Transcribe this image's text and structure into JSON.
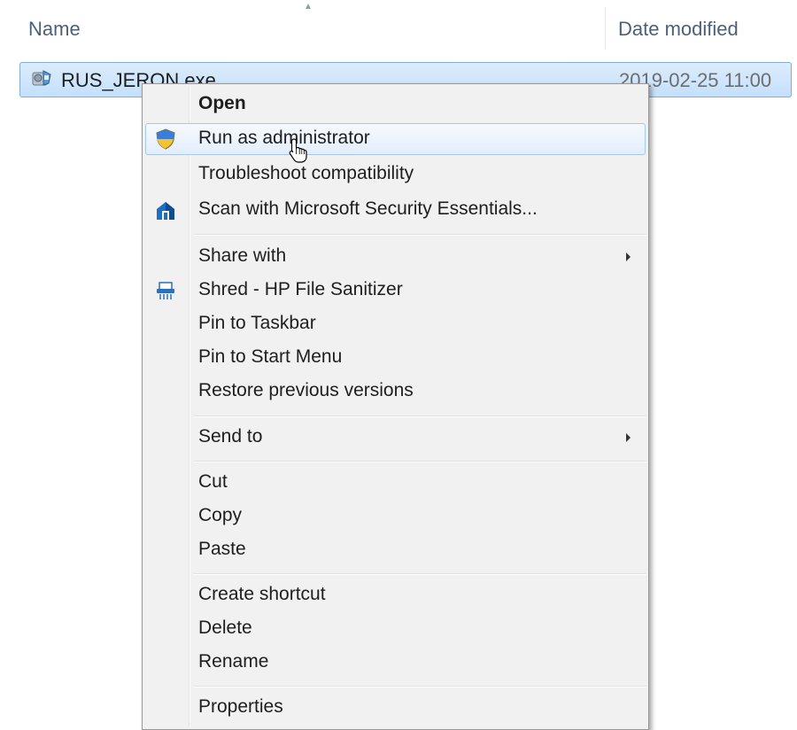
{
  "columns": {
    "name": "Name",
    "date_modified": "Date modified"
  },
  "file": {
    "name": "RUS_JERON.exe",
    "date": "2019-02-25 11:00"
  },
  "context_menu": {
    "open": "Open",
    "run_as_admin": "Run as administrator",
    "troubleshoot": "Troubleshoot compatibility",
    "scan_mse": "Scan with Microsoft Security Essentials...",
    "share_with": "Share with",
    "shred": "Shred - HP File Sanitizer",
    "pin_taskbar": "Pin to Taskbar",
    "pin_start": "Pin to Start Menu",
    "restore_versions": "Restore previous versions",
    "send_to": "Send to",
    "cut": "Cut",
    "copy": "Copy",
    "paste": "Paste",
    "create_shortcut": "Create shortcut",
    "delete": "Delete",
    "rename": "Rename",
    "properties": "Properties"
  },
  "icons": {
    "file": "application-exe-icon",
    "shield": "uac-shield-icon",
    "mse": "microsoft-security-essentials-icon",
    "shred": "hp-file-sanitizer-icon",
    "cursor": "mouse-pointer-icon"
  },
  "colors": {
    "selection": "#c4e0fc",
    "menu_bg": "#f1f1f1",
    "menu_highlight_border": "#a8c8ea",
    "header_text": "#4c607a"
  }
}
